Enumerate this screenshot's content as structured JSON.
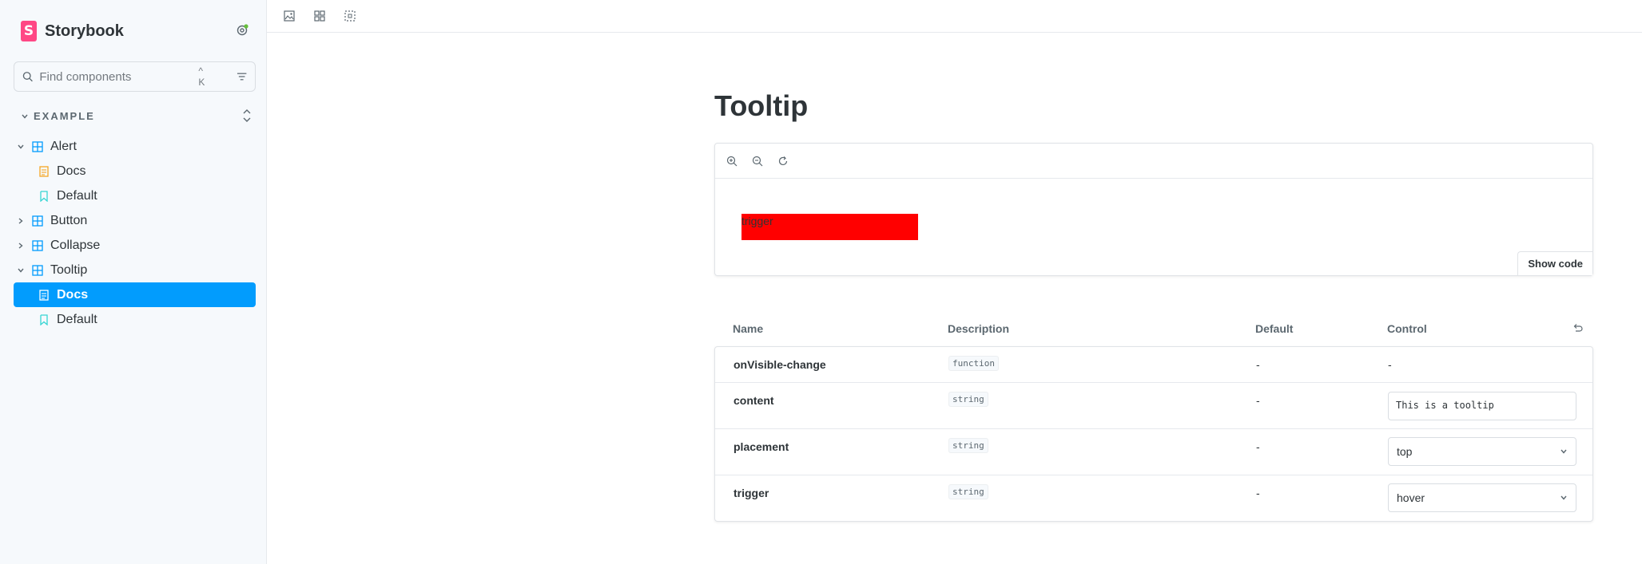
{
  "sidebar": {
    "brand": "Storybook",
    "search": {
      "placeholder": "Find components",
      "shortcut": "^ K"
    },
    "section": "EXAMPLE",
    "items": [
      {
        "label": "Alert",
        "type": "component",
        "expanded": true
      },
      {
        "label": "Docs",
        "type": "docs",
        "child": true
      },
      {
        "label": "Default",
        "type": "story",
        "child": true
      },
      {
        "label": "Button",
        "type": "component",
        "expanded": false
      },
      {
        "label": "Collapse",
        "type": "component",
        "expanded": false
      },
      {
        "label": "Tooltip",
        "type": "component",
        "expanded": true
      },
      {
        "label": "Docs",
        "type": "docs",
        "child": true,
        "selected": true
      },
      {
        "label": "Default",
        "type": "story",
        "child": true
      }
    ]
  },
  "toolbar": {
    "icons": [
      "image-icon",
      "grid-icon",
      "outline-icon"
    ]
  },
  "docs": {
    "title": "Tooltip",
    "canvas": {
      "zoom_icons": [
        "zoom-in-icon",
        "zoom-out-icon",
        "zoom-reset-icon"
      ],
      "trigger_text": "trigger",
      "show_code": "Show code"
    },
    "args_table": {
      "headers": {
        "name": "Name",
        "description": "Description",
        "default": "Default",
        "control": "Control"
      },
      "rows": [
        {
          "name": "onVisible-change",
          "type": "function",
          "default": "-",
          "control": "-"
        },
        {
          "name": "content",
          "type": "string",
          "default": "-",
          "control": "This is a tooltip"
        },
        {
          "name": "placement",
          "type": "string",
          "default": "-",
          "control": "top"
        },
        {
          "name": "trigger",
          "type": "string",
          "default": "-",
          "control": "hover"
        }
      ]
    }
  },
  "colors": {
    "accent": "#029cfd",
    "brand": "#ff4785",
    "trigger_bg": "#ff0000",
    "status_dot": "#66bf3c"
  }
}
